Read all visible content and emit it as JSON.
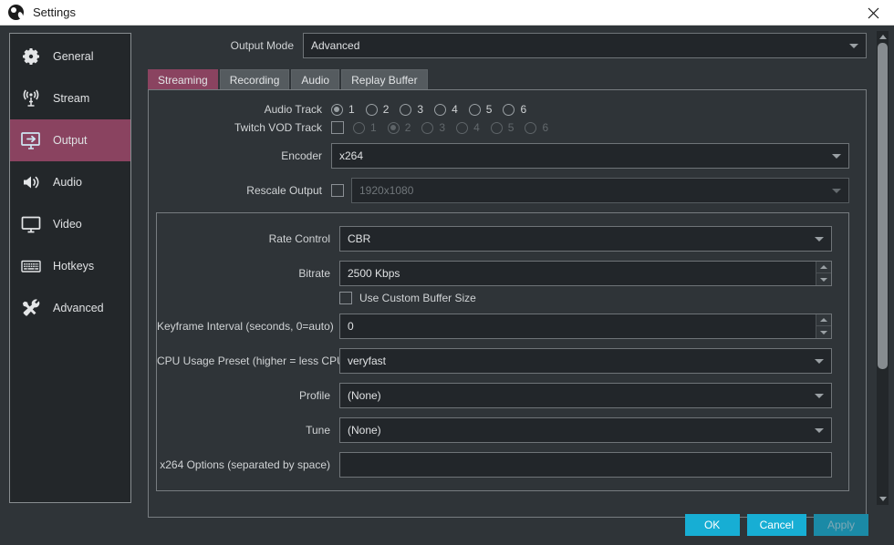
{
  "window": {
    "title": "Settings",
    "logo_icon": "obs-logo-icon",
    "close_icon": "close-icon"
  },
  "sidebar": {
    "items": [
      {
        "label": "General",
        "icon": "gear-icon",
        "active": false
      },
      {
        "label": "Stream",
        "icon": "broadcast-icon",
        "active": false
      },
      {
        "label": "Output",
        "icon": "monitor-arrow-icon",
        "active": true
      },
      {
        "label": "Audio",
        "icon": "speaker-icon",
        "active": false
      },
      {
        "label": "Video",
        "icon": "monitor-icon",
        "active": false
      },
      {
        "label": "Hotkeys",
        "icon": "keyboard-icon",
        "active": false
      },
      {
        "label": "Advanced",
        "icon": "tools-icon",
        "active": false
      }
    ]
  },
  "output_mode": {
    "label": "Output Mode",
    "value": "Advanced"
  },
  "tabs": [
    {
      "label": "Streaming",
      "active": true
    },
    {
      "label": "Recording",
      "active": false
    },
    {
      "label": "Audio",
      "active": false
    },
    {
      "label": "Replay Buffer",
      "active": false
    }
  ],
  "streaming": {
    "audio_track": {
      "label": "Audio Track",
      "options": [
        "1",
        "2",
        "3",
        "4",
        "5",
        "6"
      ],
      "selected": "1",
      "enabled": true
    },
    "twitch_vod_track": {
      "label": "Twitch VOD Track",
      "checkbox_checked": false,
      "options": [
        "1",
        "2",
        "3",
        "4",
        "5",
        "6"
      ],
      "selected": "2",
      "enabled": false
    },
    "encoder": {
      "label": "Encoder",
      "value": "x264"
    },
    "rescale_output": {
      "label": "Rescale Output",
      "checkbox_checked": false,
      "value": "1920x1080",
      "enabled": false
    },
    "rate_control": {
      "label": "Rate Control",
      "value": "CBR"
    },
    "bitrate": {
      "label": "Bitrate",
      "value": "2500 Kbps"
    },
    "use_custom_buffer_size": {
      "label": "Use Custom Buffer Size",
      "checked": false
    },
    "keyframe_interval": {
      "label": "Keyframe Interval (seconds, 0=auto)",
      "value": "0"
    },
    "cpu_usage_preset": {
      "label": "CPU Usage Preset (higher = less CPU)",
      "value": "veryfast"
    },
    "profile": {
      "label": "Profile",
      "value": "(None)"
    },
    "tune": {
      "label": "Tune",
      "value": "(None)"
    },
    "x264_options": {
      "label": "x264 Options (separated by space)",
      "value": "",
      "placeholder": ""
    }
  },
  "footer": {
    "ok": "OK",
    "cancel": "Cancel",
    "apply": "Apply",
    "apply_enabled": false
  },
  "colors": {
    "accent": "#8a4360",
    "button": "#17aed4",
    "panel_bg": "#2f3438",
    "sidebar_bg": "#23272a",
    "field_bg": "#22262a"
  }
}
